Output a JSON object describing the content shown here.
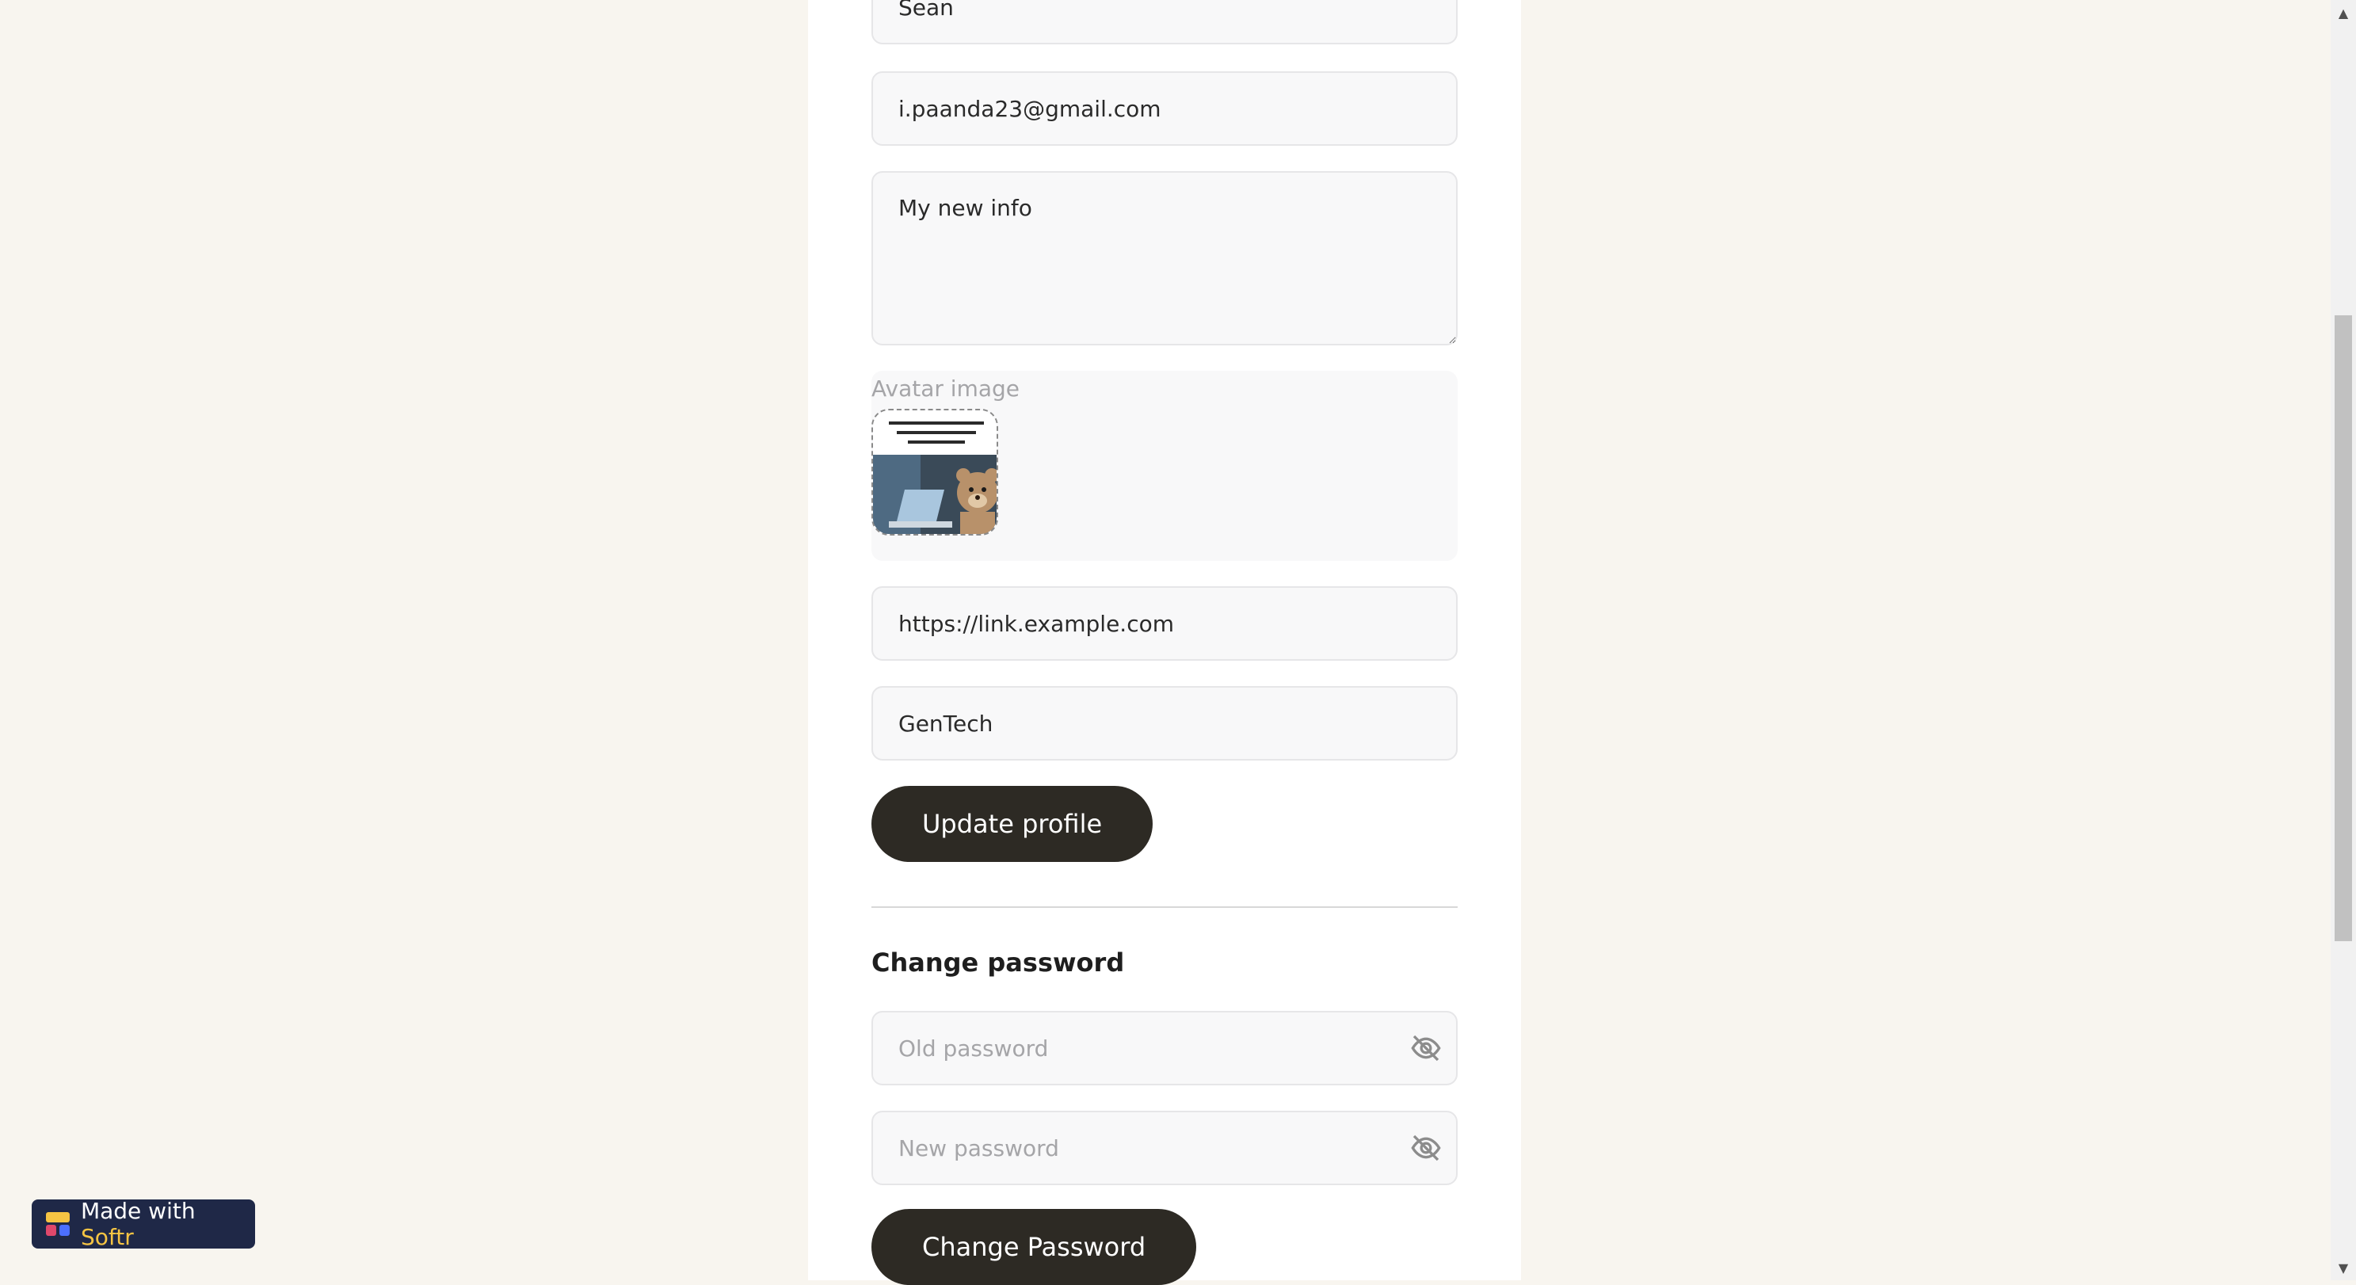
{
  "profile_form": {
    "first_name_value": "Sean",
    "email_value": "i.paanda23@gmail.com",
    "bio_value": "My new info",
    "avatar_label": "Avatar image",
    "link_value": "https://link.example.com",
    "company_value": "GenTech",
    "update_button_label": "Update profile"
  },
  "change_password": {
    "title": "Change password",
    "old_password_placeholder": "Old password",
    "new_password_placeholder": "New password",
    "submit_label": "Change Password"
  },
  "badge": {
    "prefix": "Made with",
    "brand": "Softr",
    "brand_color": "#f6c443",
    "background": "#1f2847"
  },
  "icons": {
    "password_visibility": "eye-off-icon",
    "softr_logo": "softr-logo-icon"
  },
  "theme": {
    "page_background": "#f8f5ef",
    "button_background": "#2d2a24"
  }
}
